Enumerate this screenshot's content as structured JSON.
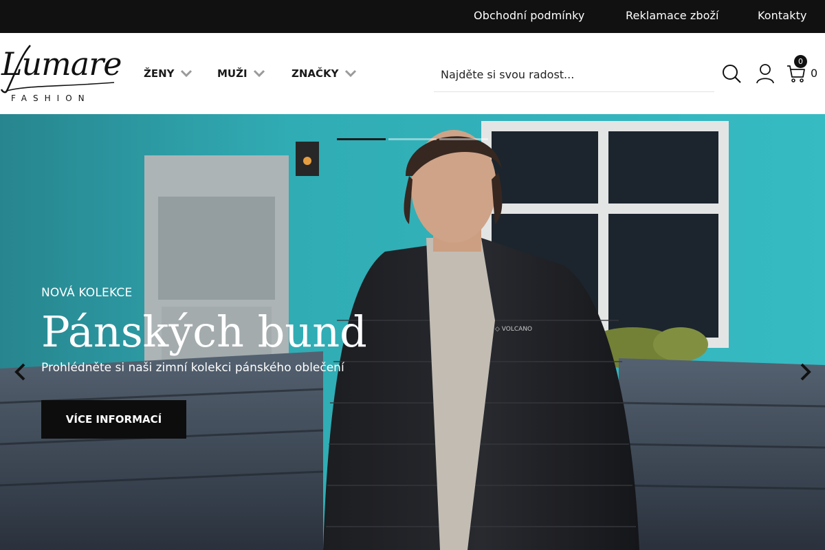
{
  "topbar": {
    "links": [
      "Obchodní podmínky",
      "Reklamace zboží",
      "Kontakty"
    ]
  },
  "header": {
    "logo": {
      "script": "Lumare",
      "sub": "FASHION"
    },
    "nav": [
      "ŽENY",
      "MUŽI",
      "ZNAČKY"
    ],
    "search_placeholder": "Najděte si svou radost...",
    "cart_count": "0",
    "cart_total": "0"
  },
  "hero": {
    "kicker": "NOVÁ KOLEKCE",
    "title": "Pánských bund",
    "subtitle": "Prohlédněte si naši zimní kolekci pánského oblečení",
    "button": "VÍCE INFORMACÍ",
    "jacket_brand": "VOLCANO",
    "slides_total": 3,
    "active_slide": 1
  },
  "icons": [
    "search-icon",
    "user-icon",
    "cart-icon",
    "chevron-down-icon",
    "arrow-left-icon",
    "arrow-right-icon"
  ],
  "colors": {
    "topbar": "#111111",
    "wall": "#2fb9c4",
    "button": "#0d0d0d"
  }
}
